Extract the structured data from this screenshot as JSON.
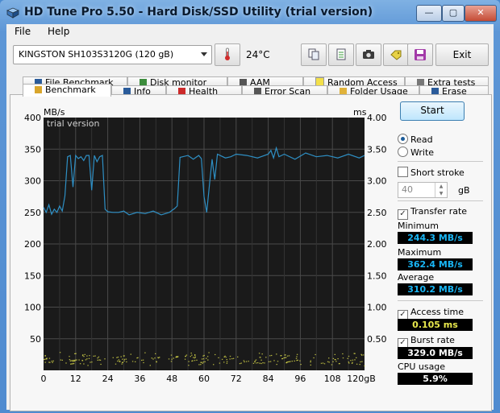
{
  "window": {
    "title": "HD Tune Pro 5.50 - Hard Disk/SSD Utility (trial version)",
    "minimize_glyph": "—",
    "maximize_glyph": "▢",
    "close_glyph": "✕"
  },
  "menu": {
    "file": "File",
    "help": "Help"
  },
  "toolbar": {
    "drive": "KINGSTON SH103S3120G (120 gB)",
    "temperature": "24°C",
    "exit_label": "Exit"
  },
  "tabs": {
    "row1": [
      "File Benchmark",
      "Disk monitor",
      "AAM",
      "Random Access",
      "Extra tests"
    ],
    "row2": [
      "Benchmark",
      "Info",
      "Health",
      "Error Scan",
      "Folder Usage",
      "Erase"
    ]
  },
  "chart_data": {
    "type": "line",
    "watermark": "trial version",
    "ylabel_left": "MB/s",
    "ylabel_right": "ms",
    "y_left_ticks": [
      "400",
      "350",
      "300",
      "250",
      "200",
      "150",
      "100",
      "50"
    ],
    "y_right_ticks": [
      "4.00",
      "3.50",
      "3.00",
      "2.50",
      "2.00",
      "1.50",
      "1.00",
      "0.50"
    ],
    "x_ticks": [
      "0",
      "12",
      "24",
      "36",
      "48",
      "60",
      "72",
      "84",
      "96",
      "108",
      "120gB"
    ],
    "xlim": [
      0,
      120
    ],
    "ylim": [
      0,
      400
    ],
    "y2lim": [
      0,
      4
    ],
    "grid": true,
    "series": [
      {
        "name": "Transfer rate",
        "color": "#2e8fc4",
        "x": [
          0,
          1,
          2,
          3,
          4,
          5,
          6,
          7,
          8,
          9,
          10,
          11,
          12,
          13,
          14,
          15,
          16,
          17,
          18,
          19,
          20,
          21,
          22,
          23,
          24,
          26,
          28,
          30,
          32,
          35,
          38,
          41,
          44,
          47,
          49,
          50,
          51,
          52,
          54,
          56,
          58,
          59,
          60,
          61,
          62,
          63,
          64,
          65,
          66,
          68,
          70,
          72,
          76,
          80,
          84,
          85,
          86,
          87,
          88,
          90,
          94,
          98,
          102,
          106,
          110,
          114,
          118,
          120
        ],
        "values": [
          258,
          250,
          262,
          247,
          255,
          250,
          260,
          252,
          276,
          338,
          340,
          290,
          340,
          335,
          338,
          332,
          340,
          340,
          285,
          340,
          330,
          338,
          340,
          255,
          251,
          250,
          250,
          252,
          246,
          250,
          248,
          252,
          246,
          250,
          256,
          260,
          337,
          338,
          340,
          334,
          340,
          335,
          275,
          250,
          292,
          334,
          302,
          342,
          340,
          336,
          338,
          342,
          340,
          336,
          342,
          348,
          336,
          352,
          338,
          342,
          334,
          344,
          338,
          340,
          336,
          342,
          336,
          340
        ]
      },
      {
        "name": "Access time",
        "color": "#e9e94d",
        "axis": "right",
        "description_values_ms": [
          0.105
        ]
      }
    ]
  },
  "side": {
    "start_label": "Start",
    "read_label": "Read",
    "write_label": "Write",
    "short_stroke_label": "Short stroke",
    "short_stroke_value": "40",
    "short_stroke_unit": "gB",
    "transfer_rate_label": "Transfer rate",
    "check_mark": "✓",
    "minimum_label": "Minimum",
    "minimum_value": "244.3 MB/s",
    "maximum_label": "Maximum",
    "maximum_value": "362.4 MB/s",
    "average_label": "Average",
    "average_value": "310.2 MB/s",
    "access_time_label": "Access time",
    "access_time_value": "0.105 ms",
    "burst_rate_label": "Burst rate",
    "burst_rate_value": "329.0 MB/s",
    "cpu_usage_label": "CPU usage",
    "cpu_usage_value": "5.9%"
  }
}
